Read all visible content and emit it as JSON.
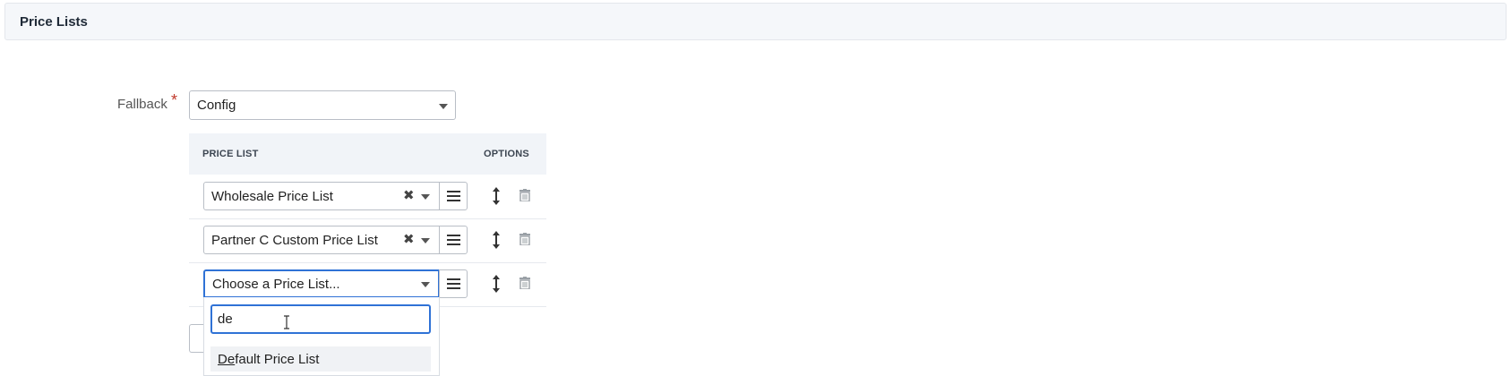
{
  "section": {
    "title": "Price Lists"
  },
  "fallback": {
    "label": "Fallback",
    "required_mark": "*",
    "value": "Config"
  },
  "grid": {
    "columns": {
      "price_list": "PRICE LIST",
      "options": "OPTIONS"
    },
    "rows": [
      {
        "value": "Wholesale Price List"
      },
      {
        "value": "Partner C Custom Price List"
      },
      {
        "value": "Choose a Price List..."
      }
    ]
  },
  "dropdown": {
    "search_value": "de",
    "results": [
      {
        "match": "De",
        "rest": "fault Price List"
      }
    ]
  },
  "colors": {
    "focus": "#2f72d6",
    "required": "#c0392b",
    "header_bg": "#f5f7fa"
  },
  "icons": [
    "chevron-down-icon",
    "clear-icon",
    "hamburger-menu-icon",
    "sort-handle-icon",
    "trash-icon",
    "text-cursor-icon"
  ]
}
